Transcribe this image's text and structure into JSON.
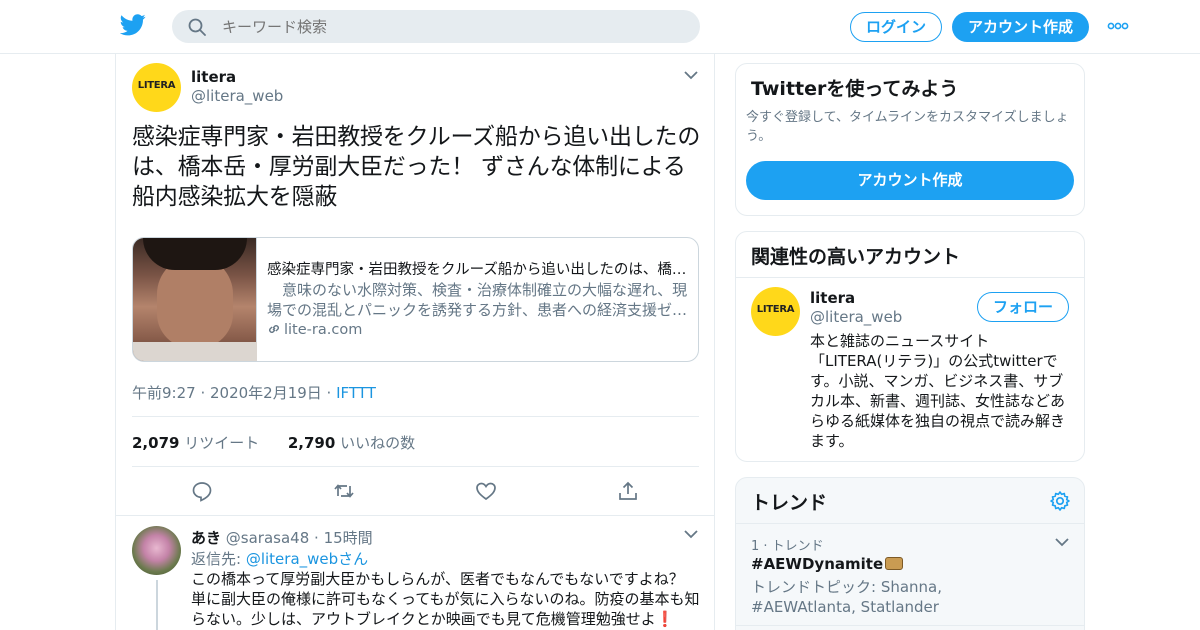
{
  "header": {
    "search_placeholder": "キーワード検索",
    "login_label": "ログイン",
    "signup_label": "アカウント作成"
  },
  "tweet": {
    "author_name": "litera",
    "author_handle": "@litera_web",
    "avatar_text": "LITERA",
    "text": "感染症専門家・岩田教授をクルーズ船から追い出したのは、橋本岳・厚労副大臣だった！ ずさんな体制による船内感染拡大を隠蔽",
    "card": {
      "title": "感染症専門家・岩田教授をクルーズ船から追い出したのは、橋本岳・厚労副大臣だった！ ずさんな体制による船内感染拡大を隠蔽",
      "description": "　意味のない水際対策、検査・治療体制確立の大幅な遅れ、現場での混乱とパニックを誘発する方針、患者への経済支援ゼ…",
      "domain": "lite-ra.com"
    },
    "timestamp": "午前9:27 · 2020年2月19日 · ",
    "source": "IFTTT",
    "retweets_count": "2,079",
    "retweets_label": "リツイート",
    "likes_count": "2,790",
    "likes_label": "いいねの数"
  },
  "reply": {
    "name": "あき",
    "handle": "@sarasa48",
    "time": "· 15時間",
    "replying_prefix": "返信先: ",
    "replying_to": "@litera_web",
    "replying_suffix": "さん",
    "text": "この橋本って厚労副大臣かもしらんが、医者でもなんでもないですよね？ 単に副大臣の俺様に許可もなくってもが気に入らないのね。防疫の基本も知らない。少しは、アウトブレイクとか映画でも見て危機管理勉強せよ❗️"
  },
  "sidebar": {
    "signup_box": {
      "title": "Twitterを使ってみよう",
      "subtitle": "今すぐ登録して、タイムラインをカスタマイズしましょう。",
      "button": "アカウント作成"
    },
    "related": {
      "title": "関連性の高いアカウント",
      "name": "litera",
      "handle": "@litera_web",
      "follow_label": "フォロー",
      "bio": "本と雑誌のニュースサイト「LITERA(リテラ)」の公式twitterです。小説、マンガ、ビジネス書、サブカル本、新書、週刊誌、女性誌などあらゆる紙媒体を独自の視点で読み解きます。"
    },
    "trends": {
      "title": "トレンド",
      "rank": "1 · トレンド",
      "tag": "#AEWDynamite",
      "topics": "トレンドトピック: Shanna, #AEWAtlanta, Statlander"
    }
  },
  "colors": {
    "brand": "#1da1f2",
    "secondary_text": "#657786",
    "link": "#1b95e0",
    "litera_yellow": "#ffd81a"
  }
}
